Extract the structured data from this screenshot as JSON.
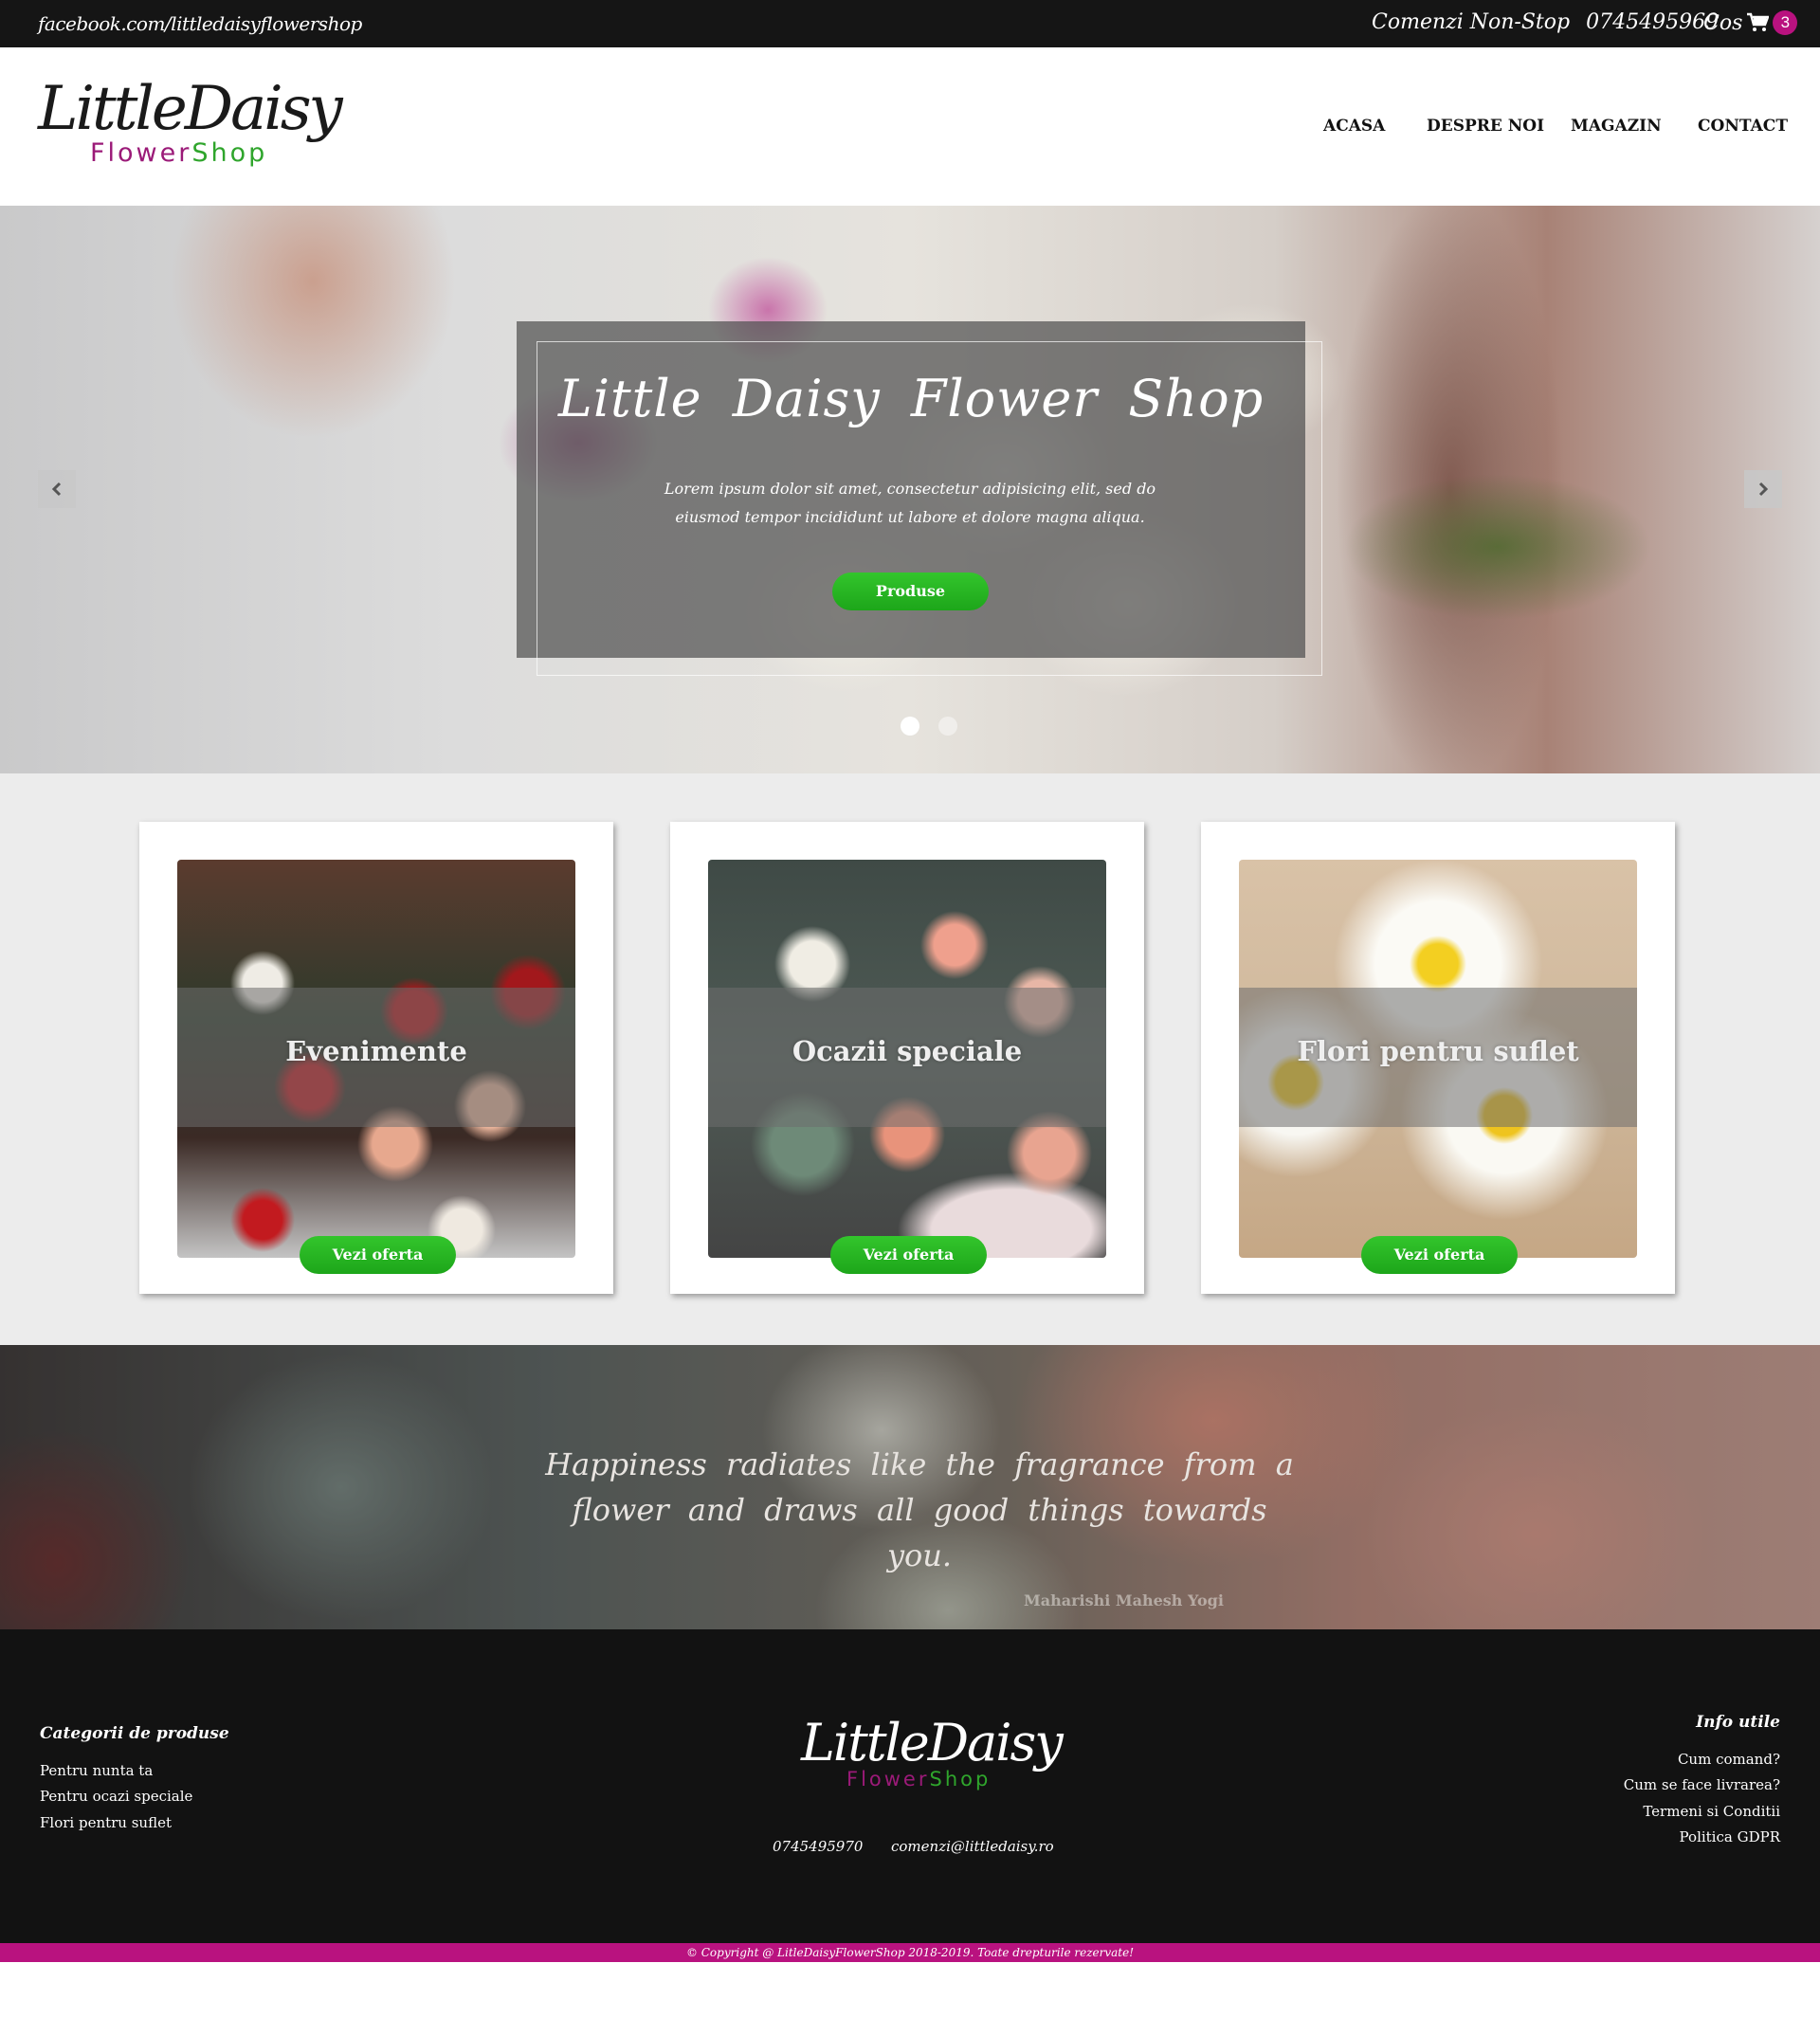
{
  "topbar": {
    "facebook": "facebook.com/littledaisyflowershop",
    "orders_label": "Comenzi Non-Stop",
    "phone": "0745495969",
    "cart_label": "Cos",
    "cart_count": "3"
  },
  "brand": {
    "logo_main": "LittleDaisy",
    "logo_sub_a": "Flower",
    "logo_sub_b": "Shop"
  },
  "nav": {
    "items": [
      "ACASA",
      "DESPRE NOI",
      "MAGAZIN",
      "CONTACT"
    ]
  },
  "hero": {
    "title": "Little Daisy Flower Shop",
    "text": "Lorem ipsum dolor sit amet, consectetur adipisicing elit, sed do eiusmod tempor incididunt ut labore et dolore magna aliqua.",
    "button": "Produse",
    "active_slide": 1,
    "slide_count": 2
  },
  "categories": [
    {
      "title": "Evenimente",
      "button": "Vezi oferta"
    },
    {
      "title": "Ocazii speciale",
      "button": "Vezi oferta"
    },
    {
      "title": "Flori pentru suflet",
      "button": "Vezi oferta"
    }
  ],
  "quote": {
    "text": "Happiness radiates like the fragrance from a flower and draws all good things towards you.",
    "author": "Maharishi Mahesh Yogi"
  },
  "footer": {
    "left_title": "Categorii de produse",
    "left_links": [
      "Pentru nunta ta",
      "Pentru ocazi speciale",
      "Flori pentru suflet"
    ],
    "phone": "0745495970",
    "email": "comenzi@littledaisy.ro",
    "right_title": "Info utile",
    "right_links": [
      "Cum comand?",
      "Cum se face livrarea?",
      "Termeni si Conditii",
      "Politica GDPR"
    ]
  },
  "copyright": "© Copyright @ LitleDaisyFlowerShop 2018-2019. Toate drepturile rezervate!",
  "colors": {
    "accent_green": "#1fae1c",
    "accent_pink": "#b9127f",
    "topbar_bg": "#151515",
    "footer_bg": "#121212"
  }
}
